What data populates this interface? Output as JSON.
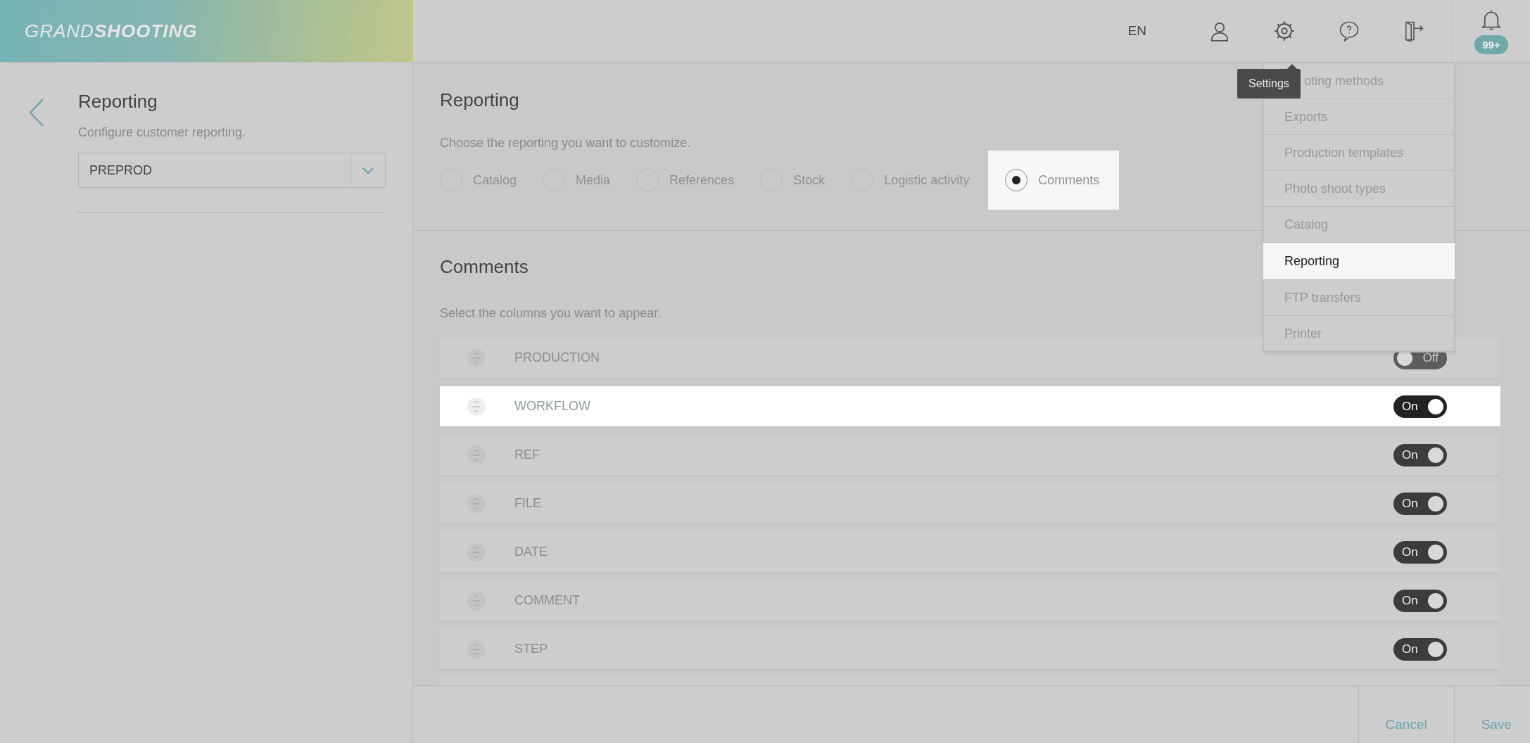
{
  "header": {
    "logo": {
      "light": "GRAND",
      "bold": "SHOOTING"
    },
    "language": "EN",
    "notifications": "99+"
  },
  "tooltip": "Settings",
  "settings_menu": [
    {
      "label": "oting methods",
      "selected": false
    },
    {
      "label": "Exports",
      "selected": false
    },
    {
      "label": "Production templates",
      "selected": false
    },
    {
      "label": "Photo shoot types",
      "selected": false
    },
    {
      "label": "Catalog",
      "selected": false
    },
    {
      "label": "Reporting",
      "selected": true
    },
    {
      "label": "FTP transfers",
      "selected": false
    },
    {
      "label": "Printer",
      "selected": false
    }
  ],
  "sidebar": {
    "title": "Reporting",
    "description": "Configure customer reporting.",
    "select": {
      "value": "PREPROD"
    }
  },
  "reporting": {
    "title": "Reporting",
    "description": "Choose the reporting you want to customize.",
    "options": [
      {
        "label": "Catalog",
        "selected": false
      },
      {
        "label": "Media",
        "selected": false
      },
      {
        "label": "References",
        "selected": false
      },
      {
        "label": "Stock",
        "selected": false
      },
      {
        "label": "Logistic activity",
        "selected": false
      },
      {
        "label": "Comments",
        "selected": true
      }
    ]
  },
  "comments": {
    "title": "Comments",
    "description": "Select the columns you want to appear.",
    "columns": [
      {
        "name": "PRODUCTION",
        "on": false,
        "toggle_label": "Off",
        "highlighted": false
      },
      {
        "name": "WORKFLOW",
        "on": true,
        "toggle_label": "On",
        "highlighted": true
      },
      {
        "name": "REF",
        "on": true,
        "toggle_label": "On",
        "highlighted": false
      },
      {
        "name": "FILE",
        "on": true,
        "toggle_label": "On",
        "highlighted": false
      },
      {
        "name": "DATE",
        "on": true,
        "toggle_label": "On",
        "highlighted": false
      },
      {
        "name": "COMMENT",
        "on": true,
        "toggle_label": "On",
        "highlighted": false
      },
      {
        "name": "STEP",
        "on": true,
        "toggle_label": "On",
        "highlighted": false
      }
    ]
  },
  "footer": {
    "buttons": [
      "Cancel",
      "Save"
    ]
  }
}
